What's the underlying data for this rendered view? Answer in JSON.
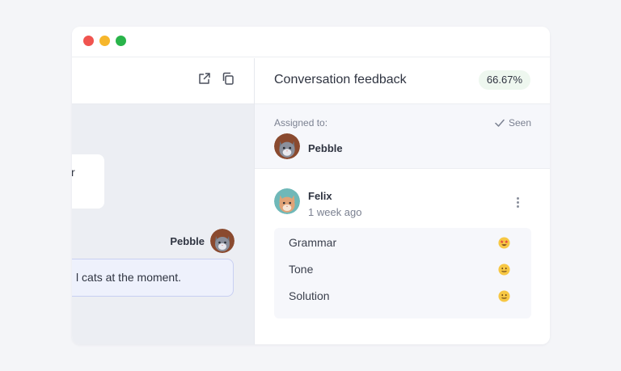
{
  "window": {
    "controls": [
      "close",
      "minimize",
      "maximize"
    ]
  },
  "chat": {
    "toolbar_icons": [
      "external-link-icon",
      "copy-icon"
    ],
    "incoming_partial_text": "r",
    "outgoing_sender": "Pebble",
    "outgoing_partial_text": "l cats at the moment."
  },
  "feedback": {
    "title": "Conversation feedback",
    "score": "66.67%",
    "assigned_label": "Assigned to:",
    "seen_label": "Seen",
    "assignee": "Pebble",
    "reviewer": "Felix",
    "review_time": "1 week ago",
    "criteria": [
      {
        "label": "Grammar",
        "emoji": "star-struck"
      },
      {
        "label": "Tone",
        "emoji": "neutral"
      },
      {
        "label": "Solution",
        "emoji": "neutral"
      }
    ]
  },
  "colors": {
    "close": "#f0544f",
    "minimize": "#f6b62c",
    "maximize": "#29b44a",
    "score_badge_bg": "#eef7ef",
    "outgoing_bubble_border": "#c8cff2"
  }
}
